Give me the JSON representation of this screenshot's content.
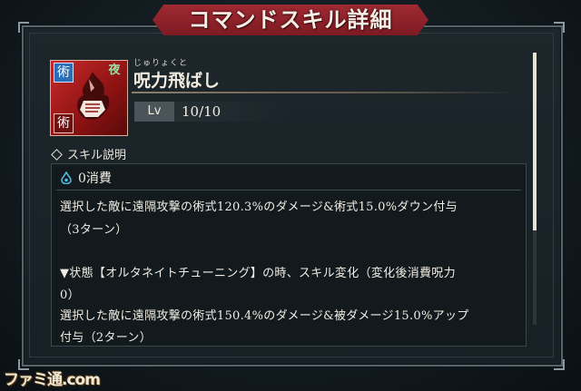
{
  "title": "コマンドスキル詳細",
  "skill": {
    "furigana": "じゅりょくと",
    "name": "呪力飛ばし",
    "icon_tag_top": "術",
    "icon_tag_bottom": "術",
    "icon_tag_corner": "夜",
    "icon": "fist-flame-icon"
  },
  "level": {
    "label": "Lv",
    "value": "10/10"
  },
  "section": {
    "label": "スキル説明"
  },
  "description": {
    "cost_icon": "cursed-energy-drop-icon",
    "cost": "0消費",
    "lines": [
      "選択した敵に遠隔攻撃の術式120.3%のダメージ&術式15.0%ダウン付与",
      "（3ターン）",
      "",
      "▼状態【オルタネイトチューニング】の時、スキル変化（変化後消費呪力",
      "0）",
      "選択した敵に遠隔攻撃の術式150.4%のダメージ&被ダメージ15.0%アップ",
      "付与（2ターン）"
    ]
  },
  "watermark": "ファミ通.com",
  "colors": {
    "banner": "#a02a33",
    "panel_border": "#56656b",
    "icon_bg": "#c92a2a",
    "cost_icon": "#4fb8d8"
  }
}
